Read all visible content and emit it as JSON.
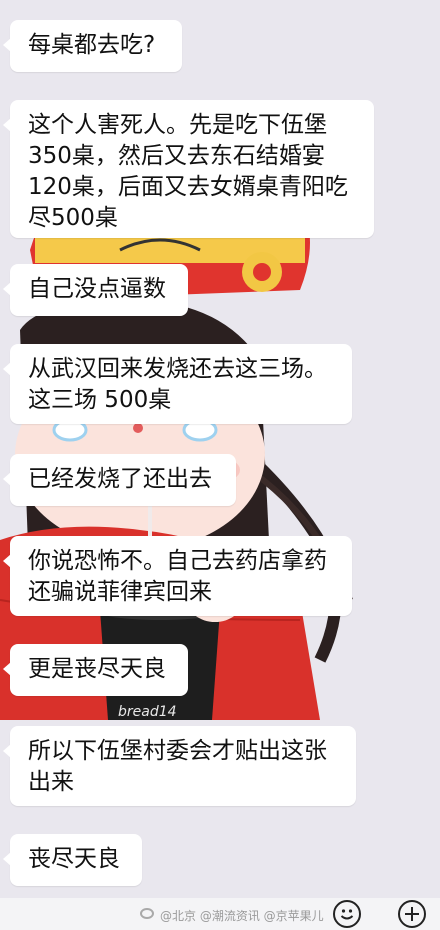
{
  "messages": [
    {
      "text": "每桌都去吃?"
    },
    {
      "text": "这个人害死人。先是吃下伍堡\n350桌，然后又去东石结婚宴\n120桌，后面又去女婿桌青阳吃\n尽500桌"
    },
    {
      "text": "自己没点逼数"
    },
    {
      "text": "从武汉回来发烧还去这三场。\n这三场 500桌"
    },
    {
      "text": "已经发烧了还出去"
    },
    {
      "text": "你说恐怖不。自己去药店拿药\n还骗说菲律宾回来"
    },
    {
      "text": "更是丧尽天良"
    },
    {
      "text": "所以下伍堡村委会才贴出这张\n出来"
    },
    {
      "text": "丧尽天良"
    }
  ],
  "wallpaper": {
    "cup_text": "bread14"
  },
  "input_bar": {
    "watermark": "@北京 @潮流资讯 @京苹果儿",
    "emoji_icon": "smile-icon",
    "plus_icon": "plus-icon"
  },
  "colors": {
    "background": "#e9e7ee",
    "bubble": "#ffffff",
    "text": "#111111",
    "wallpaper_red": "#d9312b",
    "wallpaper_hat_red": "#e0342e"
  }
}
